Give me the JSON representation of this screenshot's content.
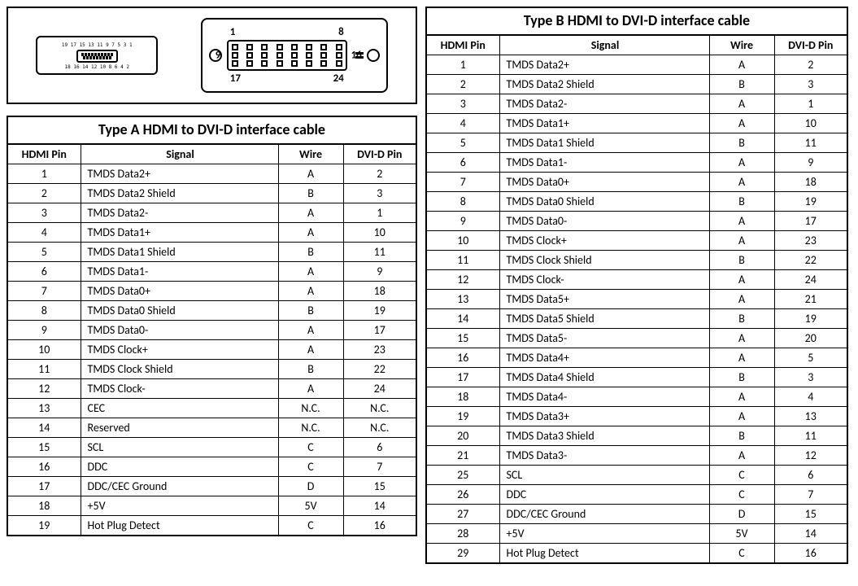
{
  "connectors": {
    "hdmi_top_nums": "19 17 15 13 11 9 7 5 3 1",
    "hdmi_bottom_nums": "18 16 14 12 10 8 6 4 2",
    "dvi_top_left": "1",
    "dvi_top_right": "8",
    "dvi_side_left": "9",
    "dvi_side_right": "16",
    "dvi_bottom_left": "17",
    "dvi_bottom_right": "24"
  },
  "tableA": {
    "title": "Type A HDMI to DVI-D interface cable",
    "headers": {
      "hdmi": "HDMI Pin",
      "signal": "Signal",
      "wire": "Wire",
      "dvi": "DVI-D Pin"
    },
    "rows": [
      {
        "hdmi": "1",
        "signal": "TMDS Data2+",
        "wire": "A",
        "dvi": "2"
      },
      {
        "hdmi": "2",
        "signal": "TMDS Data2 Shield",
        "wire": "B",
        "dvi": "3"
      },
      {
        "hdmi": "3",
        "signal": "TMDS Data2-",
        "wire": "A",
        "dvi": "1"
      },
      {
        "hdmi": "4",
        "signal": "TMDS Data1+",
        "wire": "A",
        "dvi": "10"
      },
      {
        "hdmi": "5",
        "signal": "TMDS Data1 Shield",
        "wire": "B",
        "dvi": "11"
      },
      {
        "hdmi": "6",
        "signal": "TMDS Data1-",
        "wire": "A",
        "dvi": "9"
      },
      {
        "hdmi": "7",
        "signal": "TMDS Data0+",
        "wire": "A",
        "dvi": "18"
      },
      {
        "hdmi": "8",
        "signal": "TMDS Data0 Shield",
        "wire": "B",
        "dvi": "19"
      },
      {
        "hdmi": "9",
        "signal": "TMDS Data0-",
        "wire": "A",
        "dvi": "17"
      },
      {
        "hdmi": "10",
        "signal": "TMDS Clock+",
        "wire": "A",
        "dvi": "23"
      },
      {
        "hdmi": "11",
        "signal": "TMDS Clock Shield",
        "wire": "B",
        "dvi": "22"
      },
      {
        "hdmi": "12",
        "signal": "TMDS Clock-",
        "wire": "A",
        "dvi": "24"
      },
      {
        "hdmi": "13",
        "signal": "CEC",
        "wire": "N.C.",
        "dvi": "N.C."
      },
      {
        "hdmi": "14",
        "signal": "Reserved",
        "wire": "N.C.",
        "dvi": "N.C."
      },
      {
        "hdmi": "15",
        "signal": "SCL",
        "wire": "C",
        "dvi": "6"
      },
      {
        "hdmi": "16",
        "signal": "DDC",
        "wire": "C",
        "dvi": "7"
      },
      {
        "hdmi": "17",
        "signal": "DDC/CEC Ground",
        "wire": "D",
        "dvi": "15"
      },
      {
        "hdmi": "18",
        "signal": "+5V",
        "wire": "5V",
        "dvi": "14"
      },
      {
        "hdmi": "19",
        "signal": "Hot Plug Detect",
        "wire": "C",
        "dvi": "16"
      }
    ]
  },
  "tableB": {
    "title": "Type B HDMI to DVI-D interface cable",
    "headers": {
      "hdmi": "HDMI Pin",
      "signal": "Signal",
      "wire": "Wire",
      "dvi": "DVI-D Pin"
    },
    "rows": [
      {
        "hdmi": "1",
        "signal": "TMDS Data2+",
        "wire": "A",
        "dvi": "2"
      },
      {
        "hdmi": "2",
        "signal": "TMDS Data2 Shield",
        "wire": "B",
        "dvi": "3"
      },
      {
        "hdmi": "3",
        "signal": "TMDS Data2-",
        "wire": "A",
        "dvi": "1"
      },
      {
        "hdmi": "4",
        "signal": "TMDS Data1+",
        "wire": "A",
        "dvi": "10"
      },
      {
        "hdmi": "5",
        "signal": "TMDS Data1 Shield",
        "wire": "B",
        "dvi": "11"
      },
      {
        "hdmi": "6",
        "signal": "TMDS Data1-",
        "wire": "A",
        "dvi": "9"
      },
      {
        "hdmi": "7",
        "signal": "TMDS Data0+",
        "wire": "A",
        "dvi": "18"
      },
      {
        "hdmi": "8",
        "signal": "TMDS Data0 Shield",
        "wire": "B",
        "dvi": "19"
      },
      {
        "hdmi": "9",
        "signal": "TMDS Data0-",
        "wire": "A",
        "dvi": "17"
      },
      {
        "hdmi": "10",
        "signal": "TMDS Clock+",
        "wire": "A",
        "dvi": "23"
      },
      {
        "hdmi": "11",
        "signal": "TMDS Clock Shield",
        "wire": "B",
        "dvi": "22"
      },
      {
        "hdmi": "12",
        "signal": "TMDS Clock-",
        "wire": "A",
        "dvi": "24"
      },
      {
        "hdmi": "13",
        "signal": "TMDS Data5+",
        "wire": "A",
        "dvi": "21"
      },
      {
        "hdmi": "14",
        "signal": "TMDS Data5 Shield",
        "wire": "B",
        "dvi": "19"
      },
      {
        "hdmi": "15",
        "signal": "TMDS Data5-",
        "wire": "A",
        "dvi": "20"
      },
      {
        "hdmi": "16",
        "signal": "TMDS Data4+",
        "wire": "A",
        "dvi": "5"
      },
      {
        "hdmi": "17",
        "signal": "TMDS Data4 Shield",
        "wire": "B",
        "dvi": "3"
      },
      {
        "hdmi": "18",
        "signal": "TMDS Data4-",
        "wire": "A",
        "dvi": "4"
      },
      {
        "hdmi": "19",
        "signal": "TMDS Data3+",
        "wire": "A",
        "dvi": "13"
      },
      {
        "hdmi": "20",
        "signal": "TMDS Data3 Shield",
        "wire": "B",
        "dvi": "11"
      },
      {
        "hdmi": "21",
        "signal": "TMDS Data3-",
        "wire": "A",
        "dvi": "12"
      },
      {
        "hdmi": "25",
        "signal": "SCL",
        "wire": "C",
        "dvi": "6"
      },
      {
        "hdmi": "26",
        "signal": "DDC",
        "wire": "C",
        "dvi": "7"
      },
      {
        "hdmi": "27",
        "signal": "DDC/CEC Ground",
        "wire": "D",
        "dvi": "15"
      },
      {
        "hdmi": "28",
        "signal": "+5V",
        "wire": "5V",
        "dvi": "14"
      },
      {
        "hdmi": "29",
        "signal": "Hot Plug Detect",
        "wire": "C",
        "dvi": "16"
      }
    ]
  }
}
